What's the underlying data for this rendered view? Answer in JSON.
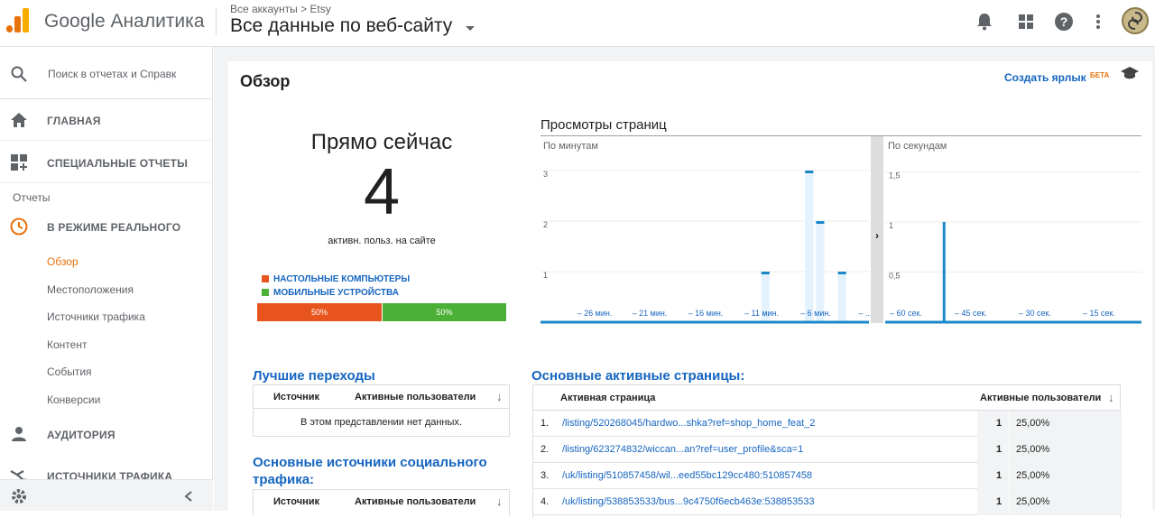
{
  "header": {
    "app_name": "Google Аналитика",
    "breadcrumb": "Все аккаунты > Etsy",
    "view_name": "Все данные по веб-сайту"
  },
  "sidebar": {
    "search_placeholder": "Поиск в отчетах и Справк",
    "home": "ГЛАВНАЯ",
    "custom": "СПЕЦИАЛЬНЫЕ ОТЧЕТЫ",
    "reports_label": "Отчеты",
    "realtime": "В РЕЖИМЕ РЕАЛЬНОГО",
    "sub_items": [
      "Обзор",
      "Местоположения",
      "Источники трафика",
      "Контент",
      "События",
      "Конверсии"
    ],
    "audience": "АУДИТОРИЯ",
    "acquisition": "ИСТОЧНИКИ ТРАФИКА"
  },
  "page": {
    "title": "Обзор",
    "shortcut": "Создать ярлык",
    "beta": "БЕТА"
  },
  "realtime": {
    "title": "Прямо сейчас",
    "active_users": "4",
    "subtitle": "активн. польз. на сайте",
    "legend_desktop": "НАСТОЛЬНЫЕ КОМПЬЮТЕРЫ",
    "legend_mobile": "МОБИЛЬНЫЕ УСТРОЙСТВА",
    "desktop_pct": "50%",
    "mobile_pct": "50%",
    "desktop_share": 0.5,
    "colors": {
      "desktop": "#e8541e",
      "mobile": "#4bb036"
    }
  },
  "pageviews": {
    "title": "Просмотры страниц",
    "minutes_label": "По минутам",
    "seconds_label": "По секундам",
    "minutes_y_ticks": [
      "3",
      "2",
      "1"
    ],
    "minutes_x_ticks": [
      "– 26 мин.",
      "– 21 мин.",
      "– 16 мин.",
      "– 11 мин.",
      "– 6 мин.",
      "– ..."
    ],
    "seconds_y_ticks": [
      "1,5",
      "1",
      "0,5"
    ],
    "seconds_x_ticks": [
      "– 60 сек.",
      "– 45 сек.",
      "– 30 сек.",
      "– 15 сек."
    ]
  },
  "chart_data": [
    {
      "type": "bar",
      "title": "По минутам",
      "ylim": [
        0,
        3
      ],
      "x": [
        -30,
        -29,
        -28,
        -27,
        -26,
        -25,
        -24,
        -23,
        -22,
        -21,
        -20,
        -19,
        -18,
        -17,
        -16,
        -15,
        -14,
        -13,
        -12,
        -11,
        -10,
        -9,
        -8,
        -7,
        -6,
        -5,
        -4,
        -3,
        -2,
        -1
      ],
      "values": [
        0,
        0,
        0,
        0,
        0,
        0,
        0,
        0,
        0,
        0,
        0,
        0,
        0,
        0,
        0,
        0,
        0,
        0,
        0,
        0,
        1,
        0,
        0,
        0,
        3,
        2,
        0,
        1,
        0,
        0
      ]
    },
    {
      "type": "bar",
      "title": "По секундам",
      "ylim": [
        0,
        1.5
      ],
      "x": [
        -45
      ],
      "values": [
        1
      ]
    }
  ],
  "referrals": {
    "title": "Лучшие переходы",
    "col_source": "Источник",
    "col_active": "Активные пользователи",
    "empty": "В этом представлении нет данных."
  },
  "social": {
    "title": "Основные источники социального трафика:",
    "col_source": "Источник",
    "col_active": "Активные пользователи"
  },
  "top_pages": {
    "title": "Основные активные страницы:",
    "col_page": "Активная страница",
    "col_active": "Активные пользователи",
    "rows": [
      {
        "n": "1.",
        "page": "/listing/520268045/hardwo...shka?ref=shop_home_feat_2",
        "count": "1",
        "pct": "25,00%"
      },
      {
        "n": "2.",
        "page": "/listing/623274832/wiccan...an?ref=user_profile&sca=1",
        "count": "1",
        "pct": "25,00%"
      },
      {
        "n": "3.",
        "page": "/uk/listing/510857458/wil...eed55bc129cc480:510857458",
        "count": "1",
        "pct": "25,00%"
      },
      {
        "n": "4.",
        "page": "/uk/listing/538853533/bus...9c4750f6ecb463e:538853533",
        "count": "1",
        "pct": "25,00%"
      }
    ]
  }
}
